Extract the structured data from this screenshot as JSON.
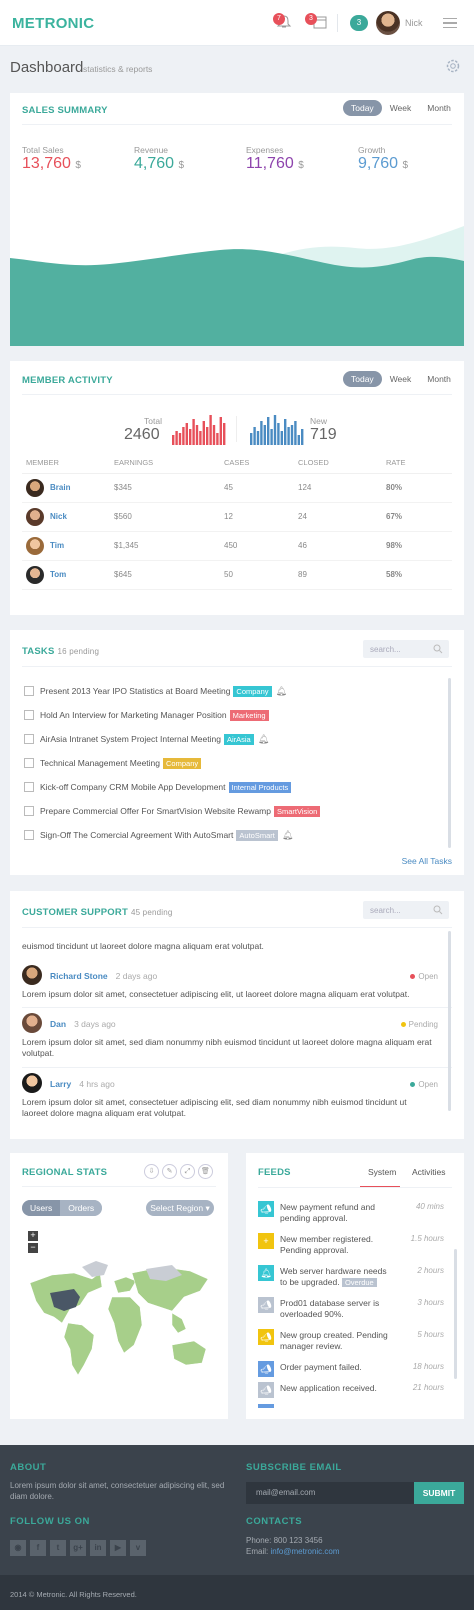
{
  "header": {
    "logo": "METRONIC",
    "notifications_count": "7",
    "calendar_count": "3",
    "inbox_count": "3",
    "user_name": "Nick"
  },
  "page": {
    "title": "Dashboard",
    "subtitle": "statistics & reports"
  },
  "sales_summary": {
    "title": "SALES SUMMARY",
    "tabs": [
      "Today",
      "Week",
      "Month"
    ],
    "stats": [
      {
        "label": "Total Sales",
        "value": "13,760",
        "unit": "$",
        "color": "#e7505a"
      },
      {
        "label": "Revenue",
        "value": "4,760",
        "unit": "$",
        "color": "#3ba99a"
      },
      {
        "label": "Expenses",
        "value": "11,760",
        "unit": "$",
        "color": "#8e44ad"
      },
      {
        "label": "Growth",
        "value": "9,760",
        "unit": "$",
        "color": "#5b9bd1"
      }
    ]
  },
  "member_activity": {
    "title": "MEMBER ACTIVITY",
    "tabs": [
      "Today",
      "Week",
      "Month"
    ],
    "total_label": "Total",
    "total_value": "2460",
    "new_label": "New",
    "new_value": "719",
    "columns": [
      "MEMBER",
      "EARNINGS",
      "CASES",
      "CLOSED",
      "RATE"
    ],
    "rows": [
      {
        "member": "Brain",
        "earnings": "$345",
        "cases": "45",
        "closed": "124",
        "rate": "80%"
      },
      {
        "member": "Nick",
        "earnings": "$560",
        "cases": "12",
        "closed": "24",
        "rate": "67%"
      },
      {
        "member": "Tim",
        "earnings": "$1,345",
        "cases": "450",
        "closed": "46",
        "rate": "98%"
      },
      {
        "member": "Tom",
        "earnings": "$645",
        "cases": "50",
        "closed": "89",
        "rate": "58%"
      }
    ]
  },
  "tasks": {
    "title": "TASKS",
    "pending": "16 pending",
    "search_placeholder": "search...",
    "items": [
      {
        "text": "Present 2013 Year IPO Statistics at Board Meeting",
        "label": "Company",
        "label_color": "#36c6d3",
        "bell": true
      },
      {
        "text": "Hold An Interview for Marketing Manager Position",
        "label": "Marketing",
        "label_color": "#ed6b75",
        "bell": false
      },
      {
        "text": "AirAsia Intranet System Project Internal Meeting",
        "label": "AirAsia",
        "label_color": "#36c6d3",
        "bell": true
      },
      {
        "text": "Technical Management Meeting",
        "label": "Company",
        "label_color": "#F1C40F",
        "bell": false
      },
      {
        "text": "Kick-off Company CRM Mobile App Development",
        "label": "Internal Products",
        "label_color": "#659be0",
        "bell": false
      },
      {
        "text": "Prepare Commercial Offer For SmartVision Website Rewamp",
        "label": "SmartVision",
        "label_color": "#ed6b75",
        "bell": false
      },
      {
        "text": "Sign-Off The Comercial Agreement With AutoSmart",
        "label": "AutoSmart",
        "label_color": "#bac3d0",
        "bell": true
      }
    ],
    "see_all": "See All Tasks"
  },
  "customer_support": {
    "title": "CUSTOMER SUPPORT",
    "pending": "45 pending",
    "search_placeholder": "search...",
    "top_text": "euismod tincidunt ut laoreet dolore magna aliquam erat volutpat.",
    "items": [
      {
        "name": "Richard Stone",
        "time": "2 days ago",
        "status": "Open",
        "status_color": "#e7505a",
        "text": "Lorem ipsum dolor sit amet, consectetuer adipiscing elit, ut laoreet dolore magna aliquam erat volutpat."
      },
      {
        "name": "Dan",
        "time": "3 days ago",
        "status": "Pending",
        "status_color": "#F1C40F",
        "text": "Lorem ipsum dolor sit amet, sed diam nonummy nibh euismod tincidunt ut laoreet dolore magna aliquam erat volutpat."
      },
      {
        "name": "Larry",
        "time": "4 hrs ago",
        "status": "Open",
        "status_color": "#3ba99a",
        "text": "Lorem ipsum dolor sit amet, consectetuer adipiscing elit, sed diam nonummy nibh euismod tincidunt ut laoreet dolore magna aliquam erat volutpat."
      }
    ]
  },
  "regional_stats": {
    "title": "REGIONAL STATS",
    "toggle": [
      "Users",
      "Orders"
    ],
    "select": "Select Region",
    "zoom_in": "+",
    "zoom_out": "−"
  },
  "feeds": {
    "title": "FEEDS",
    "tabs": [
      "System",
      "Activities"
    ],
    "items": [
      {
        "text": "New payment refund and pending approval.",
        "time": "40 mins",
        "color": "#36c6d3",
        "icon": "megaphone-icon",
        "badge": ""
      },
      {
        "text": "New member registered. Pending approval.",
        "time": "1.5 hours",
        "color": "#F1C40F",
        "icon": "plus-icon",
        "badge": ""
      },
      {
        "text": "Web server hardware needs to be upgraded.",
        "time": "2 hours",
        "color": "#36c6d3",
        "icon": "bell-icon",
        "badge": "Overdue"
      },
      {
        "text": "Prod01 database server is overloaded 90%.",
        "time": "3 hours",
        "color": "#bac3d0",
        "icon": "megaphone-icon",
        "badge": ""
      },
      {
        "text": "New group created. Pending manager review.",
        "time": "5 hours",
        "color": "#F1C40F",
        "icon": "megaphone-icon",
        "badge": ""
      },
      {
        "text": "Order payment failed.",
        "time": "18 hours",
        "color": "#659be0",
        "icon": "megaphone-icon",
        "badge": ""
      },
      {
        "text": "New application received.",
        "time": "21 hours",
        "color": "#bac3d0",
        "icon": "megaphone-icon",
        "badge": ""
      }
    ]
  },
  "footer": {
    "about_title": "ABOUT",
    "about_text": "Lorem ipsum dolor sit amet, consectetuer adipiscing elit, sed diam dolore.",
    "follow_title": "FOLLOW US ON",
    "subscribe_title": "SUBSCRIBE EMAIL",
    "email_placeholder": "mail@email.com",
    "submit": "SUBMIT",
    "contacts_title": "CONTACTS",
    "phone": "Phone: 800 123 3456",
    "email_label": "Email:",
    "email": "info@metronic.com",
    "copyright": "2014 © Metronic. All Rights Reserved."
  }
}
